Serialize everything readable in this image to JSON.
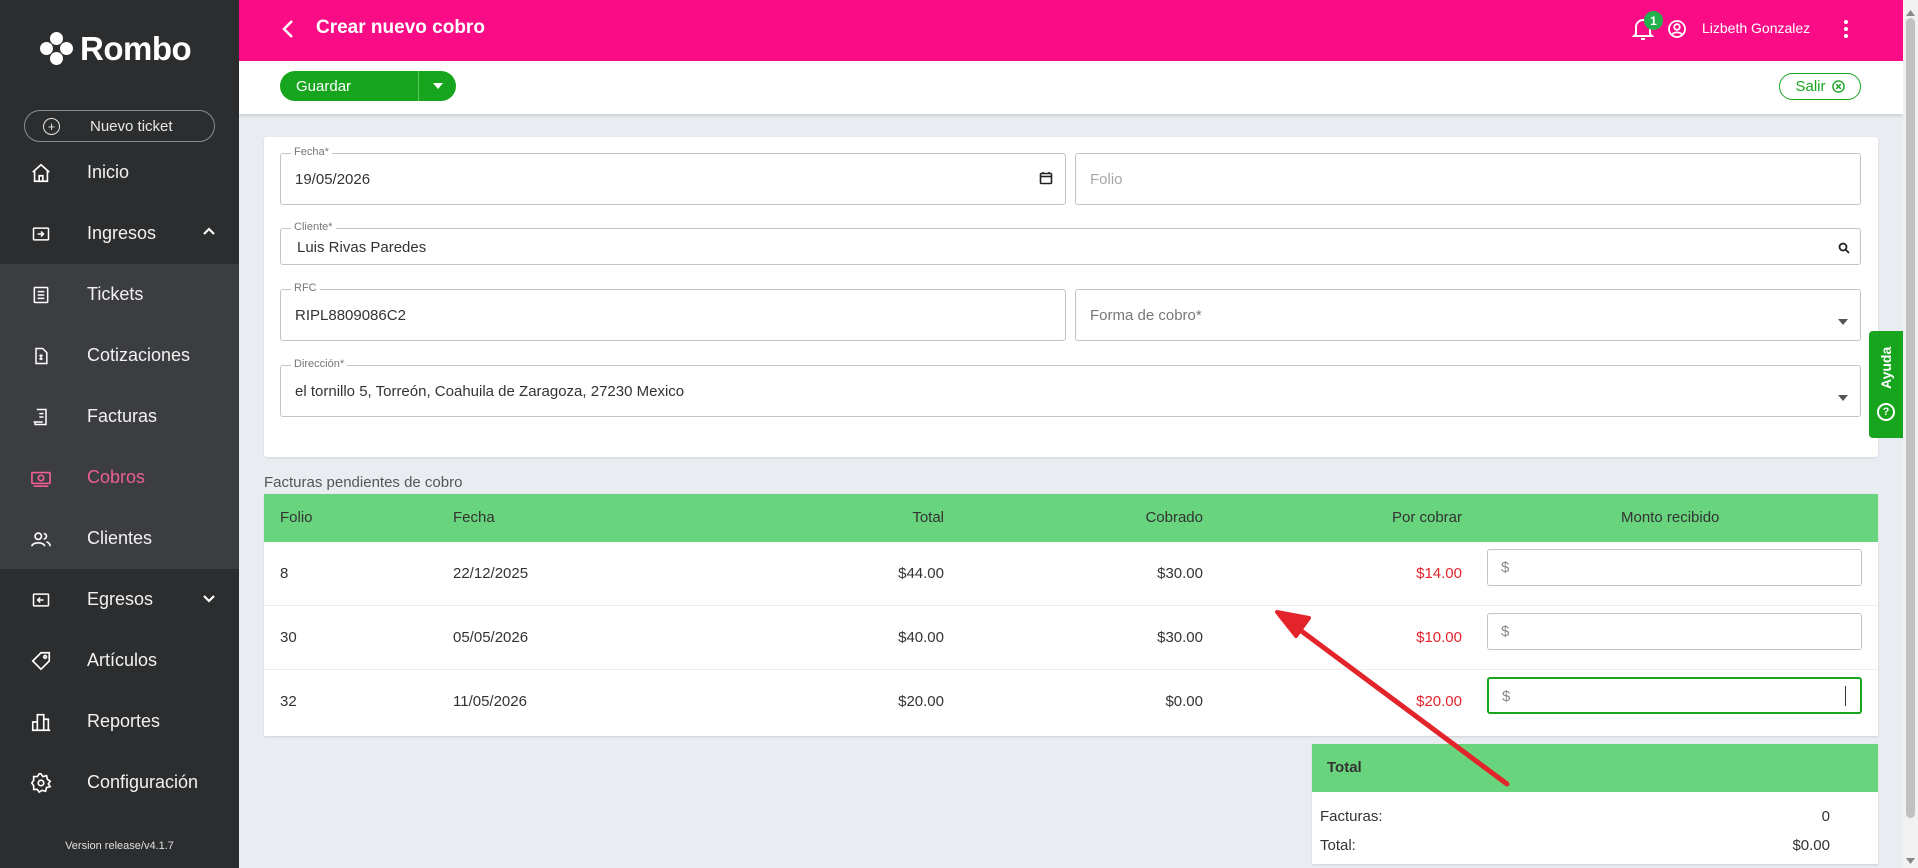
{
  "app": {
    "brand": "Rombo",
    "version": "Version release/v4.1.7"
  },
  "sidebar": {
    "new_ticket": "Nuevo ticket",
    "items": [
      {
        "label": "Inicio",
        "icon": "home-icon"
      },
      {
        "label": "Ingresos",
        "icon": "income-icon",
        "expanded": true
      },
      {
        "label": "Tickets",
        "icon": "ticket-icon"
      },
      {
        "label": "Cotizaciones",
        "icon": "quote-icon"
      },
      {
        "label": "Facturas",
        "icon": "invoice-icon"
      },
      {
        "label": "Cobros",
        "icon": "money-icon",
        "active": true
      },
      {
        "label": "Clientes",
        "icon": "users-icon"
      },
      {
        "label": "Egresos",
        "icon": "expense-icon"
      },
      {
        "label": "Artículos",
        "icon": "tag-icon"
      },
      {
        "label": "Reportes",
        "icon": "reports-icon"
      },
      {
        "label": "Configuración",
        "icon": "gear-icon"
      }
    ]
  },
  "header": {
    "title": "Crear nuevo cobro",
    "notifications": "1",
    "user": "Lizbeth Gonzalez"
  },
  "toolbar": {
    "save_label": "Guardar",
    "exit_label": "Salir"
  },
  "form": {
    "fecha": {
      "label": "Fecha*",
      "value": "19/05/2026"
    },
    "folio": {
      "placeholder": "Folio"
    },
    "cliente": {
      "label": "Cliente*",
      "value": "Luis Rivas Paredes"
    },
    "rfc": {
      "label": "RFC",
      "value": "RIPL8809086C2"
    },
    "forma_cobro": {
      "placeholder": "Forma de cobro*"
    },
    "direccion": {
      "label": "Dirección*",
      "value": "el tornillo 5, Torreón, Coahuila de Zaragoza, 27230 Mexico"
    }
  },
  "pending": {
    "title": "Facturas pendientes de cobro",
    "columns": [
      "Folio",
      "Fecha",
      "Total",
      "Cobrado",
      "Por cobrar",
      "Monto recibido"
    ],
    "currency_symbol": "$",
    "rows": [
      {
        "folio": "8",
        "fecha": "22/12/2025",
        "total": "$44.00",
        "cobrado": "$30.00",
        "por_cobrar": "$14.00"
      },
      {
        "folio": "30",
        "fecha": "05/05/2026",
        "total": "$40.00",
        "cobrado": "$30.00",
        "por_cobrar": "$10.00"
      },
      {
        "folio": "32",
        "fecha": "11/05/2026",
        "total": "$20.00",
        "cobrado": "$0.00",
        "por_cobrar": "$20.00"
      }
    ]
  },
  "totals": {
    "title": "Total",
    "facturas_label": "Facturas:",
    "facturas_value": "0",
    "total_label": "Total:",
    "total_value": "$0.00"
  },
  "help": {
    "label": "Ayuda"
  },
  "colors": {
    "header": "#fb0c87",
    "sidebar": "#2b2d2f",
    "active_nav": "#ee5f96",
    "primary_green": "#17a51e",
    "table_header": "#68d47d",
    "amount_due": "#e3242b",
    "annotation_arrow": "#e3242b"
  }
}
